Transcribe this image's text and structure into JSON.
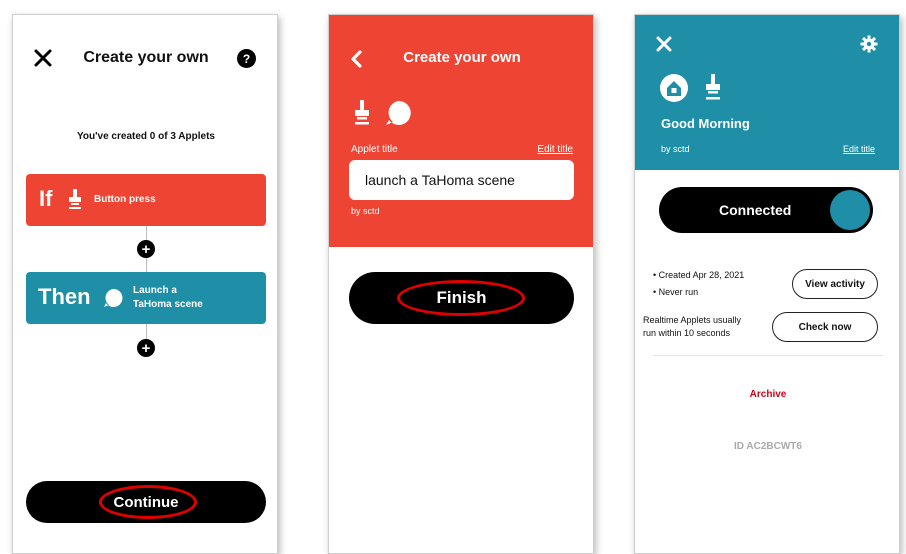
{
  "screen1": {
    "header_title": "Create your own",
    "applets_text": "You've created 0 of 3 Applets",
    "if_label": "If",
    "trigger_label": "Button press",
    "then_label": "Then",
    "action_label_line1": "Launch a",
    "action_label_line2": "TaHoma scene",
    "continue_label": "Continue",
    "colors": {
      "if": "#ee4433",
      "then": "#1f8fa8"
    }
  },
  "screen2": {
    "header_title": "Create your own",
    "applet_title_label": "Applet title",
    "edit_title_link": "Edit title",
    "title_value": "launch a TaHoma scene",
    "by_label": "by sctd",
    "finish_label": "Finish",
    "colors": {
      "header": "#ee4433"
    }
  },
  "screen3": {
    "applet_name": "Good Morning",
    "by_label": "by sctd",
    "edit_title_link": "Edit title",
    "connected_label": "Connected",
    "created_text": "• Created Apr 28, 2021",
    "never_run_text": "• Never run",
    "view_activity_label": "View activity",
    "realtime_line1": "Realtime Applets usually",
    "realtime_line2": "run within 10 seconds",
    "check_now_label": "Check now",
    "archive_label": "Archive",
    "id_text": "ID AC2BCWT6",
    "colors": {
      "header": "#1f8fa8",
      "archive": "#d0021b"
    }
  }
}
